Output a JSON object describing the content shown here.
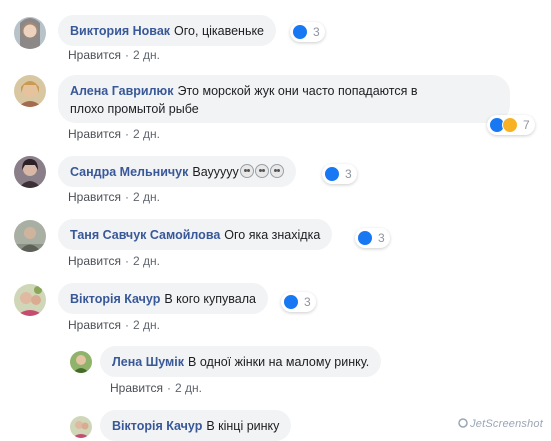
{
  "comments": [
    {
      "author": "Виктория Новак",
      "text": "Ого, цікавеньке",
      "like_label": "Нравится",
      "time": "2 дн.",
      "reactions": "3"
    },
    {
      "author": "Алена Гаврилюк",
      "text_line1": "Это морской жук они часто попадаются в",
      "text_line2": "плохо промытой рыбе",
      "like_label": "Нравится",
      "time": "2 дн.",
      "reactions": "7"
    },
    {
      "author": "Сандра Мельничук",
      "text": "Вауyyyy",
      "like_label": "Нравится",
      "time": "2 дн.",
      "reactions": "3"
    },
    {
      "author": "Таня Савчук Самойлова",
      "text": "Ого яка знахідка",
      "like_label": "Нравится",
      "time": "2 дн.",
      "reactions": "3"
    },
    {
      "author": "Вікторія Качур",
      "text": "В кого купувала",
      "like_label": "Нравится",
      "time": "2 дн.",
      "reactions": "3"
    }
  ],
  "replies": [
    {
      "author": "Лена Шумік",
      "text": "В одної жінки на малому ринку.",
      "like_label": "Нравится",
      "time": "2 дн."
    },
    {
      "author": "Вікторія Качур",
      "text": "В кінці ринку"
    }
  ],
  "separator": "·",
  "watermark": "JetScreenshot",
  "colors": {
    "author": "#385898",
    "bubble": "#f2f3f5",
    "like": "#1877f2",
    "wow": "#f7b125"
  }
}
